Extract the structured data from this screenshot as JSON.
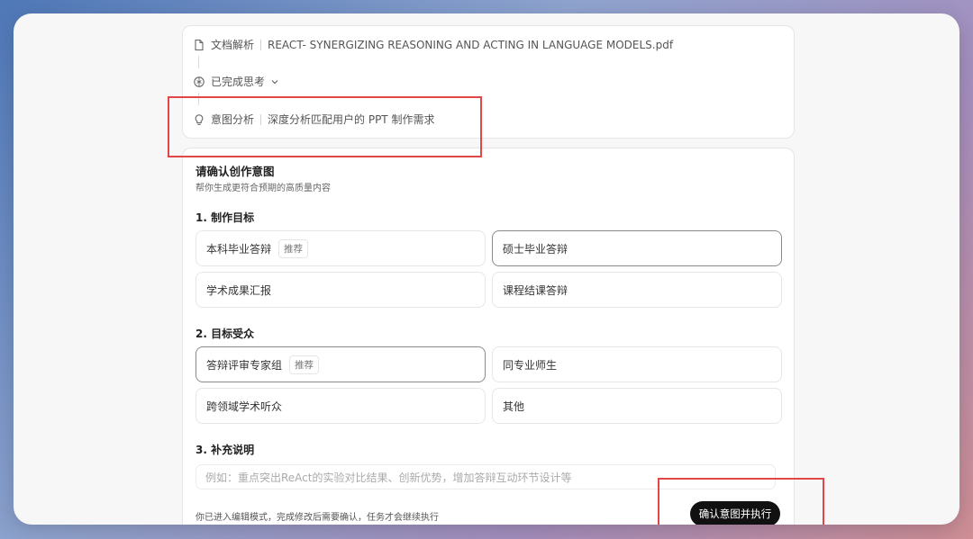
{
  "header": {
    "doc_label": "文档解析",
    "doc_filename": "REACT- SYNERGIZING REASONING AND ACTING IN LANGUAGE MODELS.pdf",
    "thinking_label": "已完成思考",
    "intent_label": "意图分析",
    "intent_desc": "深度分析匹配用户的 PPT 制作需求"
  },
  "form": {
    "title": "请确认创作意图",
    "subtitle": "帮你生成更符合预期的高质量内容",
    "sections": [
      {
        "title": "1. 制作目标",
        "options": [
          {
            "label": "本科毕业答辩",
            "tag": "推荐",
            "selected": false
          },
          {
            "label": "硕士毕业答辩",
            "tag": "",
            "selected": true
          },
          {
            "label": "学术成果汇报",
            "tag": "",
            "selected": false
          },
          {
            "label": "课程结课答辩",
            "tag": "",
            "selected": false
          }
        ]
      },
      {
        "title": "2. 目标受众",
        "options": [
          {
            "label": "答辩评审专家组",
            "tag": "推荐",
            "selected": true
          },
          {
            "label": "同专业师生",
            "tag": "",
            "selected": false
          },
          {
            "label": "跨领域学术听众",
            "tag": "",
            "selected": false
          },
          {
            "label": "其他",
            "tag": "",
            "selected": false
          }
        ]
      }
    ],
    "supplement_title": "3. 补充说明",
    "supplement_placeholder": "例如：重点突出ReAct的实验对比结果、创新优势，增加答辩互动环节设计等",
    "footer_text": "你已进入编辑模式，完成修改后需要确认，任务才会继续执行",
    "confirm_label": "确认意图并执行"
  },
  "colors": {
    "annotation": "#e04848",
    "button_bg": "#111111"
  }
}
